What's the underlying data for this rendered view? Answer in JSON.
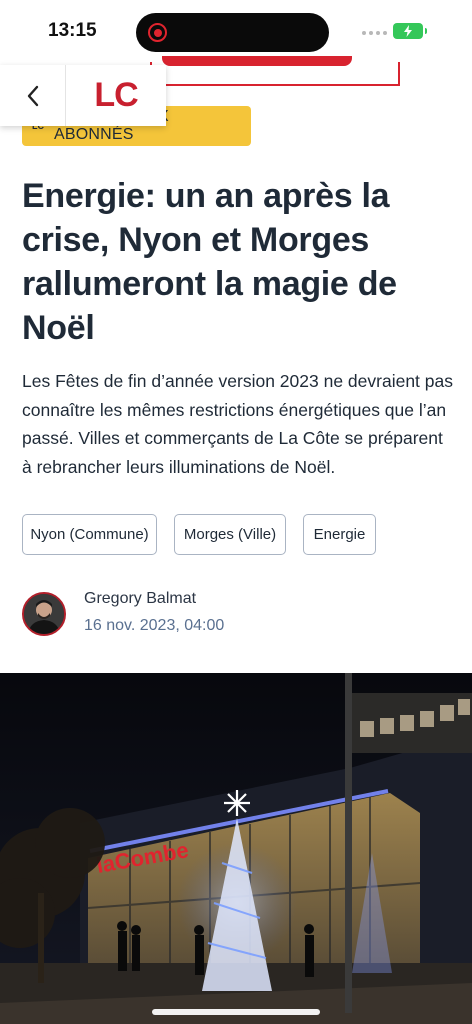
{
  "status_bar": {
    "time": "13:15"
  },
  "header": {
    "logo": "LC",
    "back_label": "Back"
  },
  "badge": {
    "logo": "LC",
    "label": "RÉSERVÉ AUX ABONNÉS"
  },
  "article": {
    "title": "Energie: un an après la crise, Nyon et Morges rallumeront la magie de Noël",
    "lead": "Les Fêtes de fin d’année version 2023 ne devraient pas connaître les mêmes restrictions énergétiques que l’an passé. Villes et commerçants de La Côte se préparent à rebrancher leurs illuminations de Noël.",
    "tags": [
      "Nyon (Commune)",
      "Morges (Ville)",
      "Energie"
    ],
    "author": {
      "name": "Gregory Balmat",
      "date": "16 nov. 2023, 04:00"
    },
    "hero_sign": "laCombe"
  },
  "colors": {
    "brand": "#c8202f",
    "badge": "#f4c53a",
    "text": "#1f2a37",
    "date": "#5a7090"
  }
}
